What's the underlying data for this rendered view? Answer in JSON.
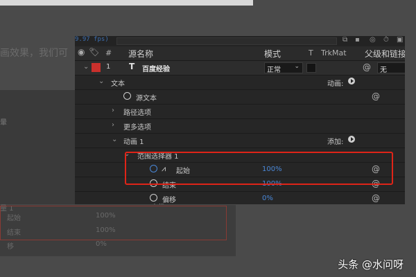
{
  "background": {
    "left_text": "画效果，我们可",
    "left_word": "暈",
    "lower_rows": [
      {
        "label": "起始",
        "value": "100%"
      },
      {
        "label": "结束",
        "value": "100%"
      },
      {
        "label": "移",
        "value": "0%"
      }
    ],
    "lower_label": "量 1"
  },
  "panel": {
    "fps": "9.97 fps)",
    "header": {
      "source_name": "源名称",
      "mode": "模式",
      "t": "T",
      "trkmat": "TrkMat",
      "parent": "父级和链接",
      "hash": "#"
    },
    "layer": {
      "number": "1",
      "type_icon": "T",
      "name": "百度经验",
      "mode": "正常",
      "parent": "无",
      "color": "#c9302c"
    },
    "rows": {
      "text_group": "文本",
      "animate_label": "动画:",
      "source_text": "源文本",
      "path_options": "路径选项",
      "more_options": "更多选项",
      "animator": "动画 1",
      "add_label": "添加:",
      "range_selector": "范围选择器 1",
      "start": "起始",
      "start_value": "100%",
      "end": "结束",
      "end_value": "100%",
      "offset": "偏移",
      "offset_value": "0%",
      "advanced": "高级"
    }
  },
  "watermark": "头条 @水问呀",
  "colors": {
    "highlight_box": "#e02418",
    "value_blue": "#4a88d8"
  }
}
